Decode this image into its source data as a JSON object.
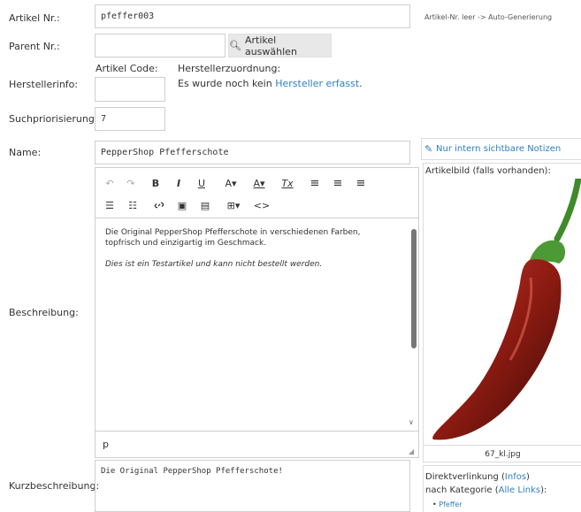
{
  "labels": {
    "artikel_nr": "Artikel Nr.:",
    "parent_nr": "Parent Nr.:",
    "herstellerinfo": "Herstellerinfo:",
    "suchpriorisierung": "Suchpriorisierung:",
    "name": "Name:",
    "beschreibung": "Beschreibung:",
    "kurzbeschreibung": "Kurzbeschreibung:"
  },
  "fields": {
    "artikel_nr_value": "pfeffer003",
    "artikel_nr_hint": "Artikel-Nr. leer -> Auto-Generierung",
    "parent_nr_value": "",
    "artikel_auswaehlen_label": "Artikel auswählen",
    "artikel_code_label": "Artikel Code:",
    "artikel_code_value": "",
    "herstellerzuordnung_label": "Herstellerzuordnung:",
    "hersteller_text": "Es wurde noch kein ",
    "hersteller_link": "Hersteller erfasst",
    "hersteller_dot": ".",
    "suchpriorisierung_value": "7",
    "name_value": "PepperShop Pfefferschote",
    "kurzbeschreibung_value": "Die Original PepperShop Pfefferschote!"
  },
  "editor": {
    "paragraph1": "Die Original PepperShop Pfefferschote in verschiedenen Farben, topfrisch und einzigartig im Geschmack.",
    "paragraph2": "Dies ist ein Testartikel und kann nicht bestellt werden.",
    "status_path": "p",
    "toolbar": {
      "undo": "↶",
      "redo": "↷",
      "bold": "B",
      "italic": "I",
      "underline": "U",
      "font_size": "A▾",
      "font_color": "A▾",
      "clear_format": "Tx",
      "bullet_list": "☰",
      "numbered_list": "☷",
      "link": "🔗",
      "image": "▣",
      "media": "▤",
      "table": "⊞▾",
      "code": "<>"
    }
  },
  "side": {
    "notes_link": "Nur intern sichtbare Notizen",
    "artikelbild_label": "Artikelbild (falls vorhanden):",
    "image_filename": "67_kl.jpg",
    "direktverlinkung": "Direktverlinkung (",
    "infos_link": "Infos",
    "close_paren": ")",
    "nach_kategorie": "nach Kategorie (",
    "alle_links": "Alle Links",
    "colon_paren": "):",
    "category_item": "Pfeffer"
  }
}
